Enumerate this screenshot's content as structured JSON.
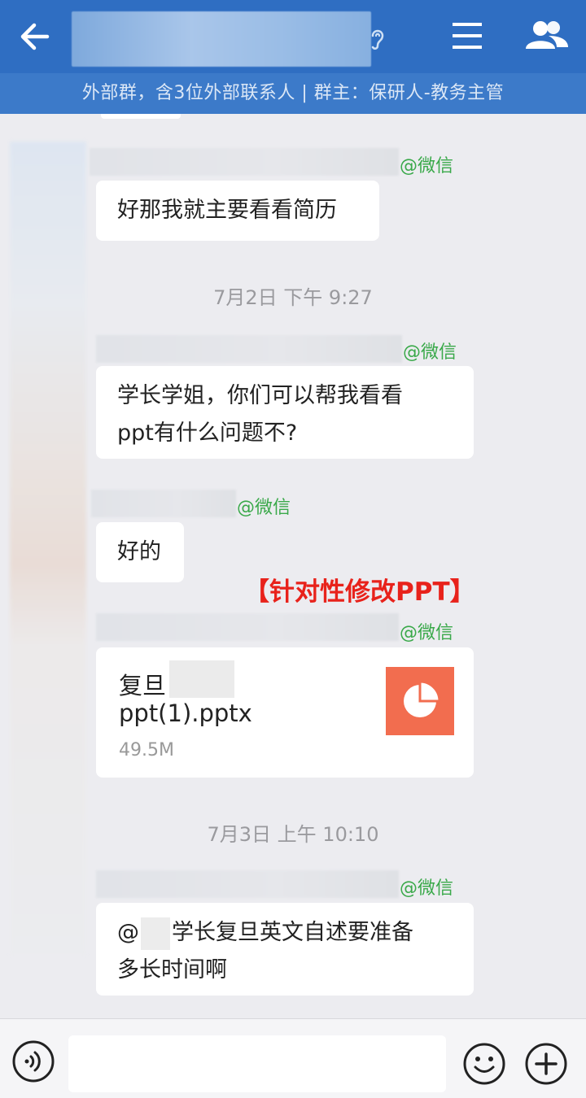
{
  "header": {
    "group_info": "外部群，含3位外部联系人 | 群主：保研人-教务主管"
  },
  "messages": [
    {
      "source_tag": "@微信",
      "text": "好那我就主要看看简历"
    },
    {
      "timestamp": "7月2日  下午 9:27"
    },
    {
      "source_tag": "@微信",
      "text_line1": "学长学姐，你们可以帮我看看",
      "text_line2": "ppt有什么问题不?"
    },
    {
      "source_tag": "@微信",
      "text": "好的"
    },
    {
      "annotation": "【针对性修改PPT】"
    },
    {
      "source_tag": "@微信",
      "file": {
        "name_line1": "复旦",
        "name_line2": "ppt(1).pptx",
        "size": "49.5M",
        "icon": "ppt-pie-icon"
      }
    },
    {
      "timestamp": "7月3日  上午 10:10"
    },
    {
      "source_tag": "@微信",
      "mention_prefix": "@",
      "text_line1": "学长复旦英文自述要准备",
      "text_line2": "多长时间啊"
    }
  ],
  "input": {
    "placeholder": ""
  },
  "colors": {
    "header_bg": "#2f6ec2",
    "subbar_bg": "#3c7ac9",
    "wechat_tag": "#3aa94a",
    "annotation": "#e8221b",
    "ppt_icon": "#f26d4f"
  }
}
